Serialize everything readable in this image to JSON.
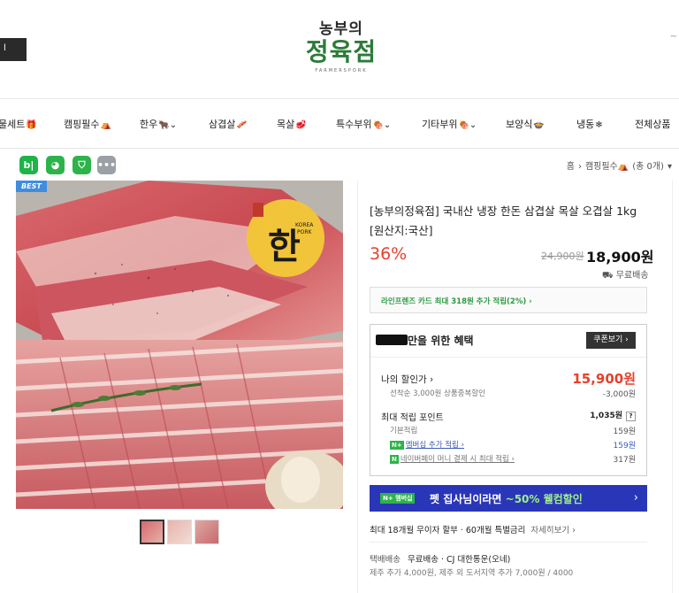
{
  "header": {
    "left_button": "l",
    "logo_top": "농부의",
    "logo_main": "정육점",
    "logo_sub": "FARMERSPORK",
    "corner": "~"
  },
  "nav": {
    "items": [
      {
        "label": "물세트",
        "icon": "🎁"
      },
      {
        "label": "캠핑필수",
        "icon": "⛺"
      },
      {
        "label": "한우",
        "icon": "🐂⌄"
      },
      {
        "label": "삼겹살",
        "icon": "🥓"
      },
      {
        "label": "목살",
        "icon": "🥩"
      },
      {
        "label": "특수부위",
        "icon": "🍖⌄"
      },
      {
        "label": "기타부위",
        "icon": "🍖⌄"
      },
      {
        "label": "보양식",
        "icon": "🍲"
      },
      {
        "label": "냉동",
        "icon": "❄"
      },
      {
        "label": "전체상품",
        "icon": ""
      }
    ]
  },
  "share": {
    "buttons": [
      {
        "label": "b|",
        "color": "#1fb34a"
      },
      {
        "label": "◕",
        "color": "#2db34a"
      },
      {
        "label": "⛉",
        "color": "#2db34a"
      },
      {
        "label": "•••",
        "color": "#9aa0a6"
      }
    ]
  },
  "breadcrumb": {
    "home": "홈",
    "sep": "›",
    "category": "캠핑필수⛺",
    "count": "(총 0개)",
    "arrow": "▾"
  },
  "badge": {
    "best": "BEST"
  },
  "product": {
    "title": "[농부의정육점] 국내산 냉장 한돈 삼겹살 목살 오겹살 1kg [원산지:국산]",
    "discount": "36%",
    "original_price": "24,900원",
    "sale_price": "18,900원",
    "free_shipping": "⛟ 무료배송"
  },
  "card_promo": {
    "text": "라인프렌즈 카드 최대 318원 추가 적립(2%) ›"
  },
  "benefit": {
    "title": "만을 위한 혜택",
    "coupon_btn": "쿠폰보기 ›",
    "my_discount_label": "나의 할인가 ›",
    "my_discount_price": "15,900원",
    "sub_discount_label": "선착순 3,000원 상품중복할인",
    "sub_discount_value": "-3,000원",
    "points_label": "최대 적립 포인트",
    "points_value": "1,035원",
    "points_help": "?",
    "basic_label": "기본적립",
    "basic_value": "159원",
    "member_badge": "N+",
    "member_label": "멤버십 추가 적립 ›",
    "member_value": "159원",
    "pay_badge": "N",
    "pay_label": "네이버페이 머니 결제 시 최대 적립 ›",
    "pay_value": "317원"
  },
  "promo": {
    "badge": "N+ 멤버십",
    "text_prefix": "펫 집사님이라면 ",
    "text_highlight": "~50% 웰컴할인",
    "arrow": "›"
  },
  "installment": {
    "text": "최대 18개월 무이자 할부 · 60개월 특별금리",
    "more": "자세히보기 ›"
  },
  "shipping": {
    "label": "택배배송",
    "value": "무료배송 · CJ 대한통운(오네)",
    "extra": "제주 추가 4,000원, 제주 외 도서지역 추가 7,000원 / 4000"
  },
  "colors": {
    "brand_green": "#2d7a3a",
    "price_red": "#e8402c",
    "promo_blue": "#2a36b8"
  }
}
